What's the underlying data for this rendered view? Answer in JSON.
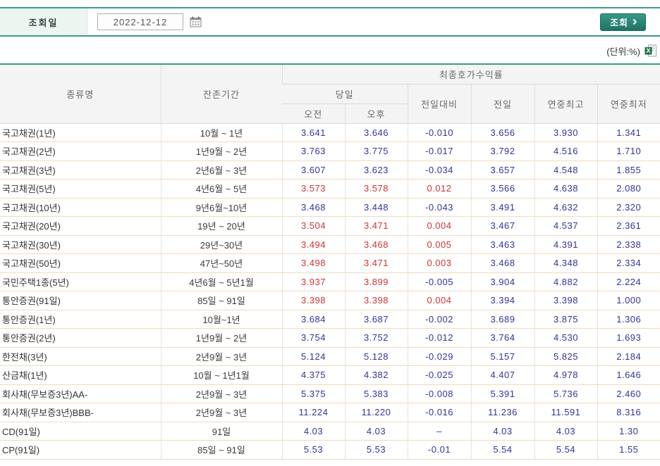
{
  "accent_color": "#3d9a8b",
  "colors": {
    "up": "#cc3333",
    "down": "#333399",
    "row_line": "#f0dac0"
  },
  "toolbar": {
    "date_label": "조회일",
    "date_value": "2022-12-12",
    "calendar_icon": "calendar-icon",
    "search_button_label": "조회"
  },
  "unit_note": "(단위:%)",
  "excel_icon": "excel-download-icon",
  "table": {
    "headers": {
      "type": "종류명",
      "period": "잔존기간",
      "yield_group": "최종호가수익률",
      "today": "당일",
      "am": "오전",
      "pm": "오후",
      "change": "전일대비",
      "prev": "전일",
      "year_high": "연중최고",
      "year_low": "연중최저"
    },
    "rows": [
      {
        "type": "국고채권(1년)",
        "period": "10월 ~ 1년",
        "am": "3.641",
        "pm": "3.646",
        "change": "-0.010",
        "prev": "3.656",
        "high": "3.930",
        "low": "1.341",
        "am_tone": "down",
        "pm_tone": "down",
        "change_tone": "down"
      },
      {
        "type": "국고채권(2년)",
        "period": "1년9월 ~ 2년",
        "am": "3.763",
        "pm": "3.775",
        "change": "-0.017",
        "prev": "3.792",
        "high": "4.516",
        "low": "1.710",
        "am_tone": "down",
        "pm_tone": "down",
        "change_tone": "down"
      },
      {
        "type": "국고채권(3년)",
        "period": "2년6월 ~ 3년",
        "am": "3.607",
        "pm": "3.623",
        "change": "-0.034",
        "prev": "3.657",
        "high": "4.548",
        "low": "1.855",
        "am_tone": "down",
        "pm_tone": "down",
        "change_tone": "down"
      },
      {
        "type": "국고채권(5년)",
        "period": "4년6월 ~ 5년",
        "am": "3.573",
        "pm": "3.578",
        "change": "0.012",
        "prev": "3.566",
        "high": "4.638",
        "low": "2.080",
        "am_tone": "up",
        "pm_tone": "up",
        "change_tone": "up"
      },
      {
        "type": "국고채권(10년)",
        "period": "9년6월~10년",
        "am": "3.468",
        "pm": "3.448",
        "change": "-0.043",
        "prev": "3.491",
        "high": "4.632",
        "low": "2.320",
        "am_tone": "down",
        "pm_tone": "down",
        "change_tone": "down"
      },
      {
        "type": "국고채권(20년)",
        "period": "19년 ~ 20년",
        "am": "3.504",
        "pm": "3.471",
        "change": "0.004",
        "prev": "3.467",
        "high": "4.537",
        "low": "2.361",
        "am_tone": "up",
        "pm_tone": "up",
        "change_tone": "up"
      },
      {
        "type": "국고채권(30년)",
        "period": "29년~30년",
        "am": "3.494",
        "pm": "3.468",
        "change": "0.005",
        "prev": "3.463",
        "high": "4.391",
        "low": "2.338",
        "am_tone": "up",
        "pm_tone": "up",
        "change_tone": "up"
      },
      {
        "type": "국고채권(50년)",
        "period": "47년~50년",
        "am": "3.498",
        "pm": "3.471",
        "change": "0.003",
        "prev": "3.468",
        "high": "4.348",
        "low": "2.334",
        "am_tone": "up",
        "pm_tone": "up",
        "change_tone": "up"
      },
      {
        "type": "국민주택1종(5년)",
        "period": "4년6월 ~ 5년1월",
        "am": "3.937",
        "pm": "3.899",
        "change": "-0.005",
        "prev": "3.904",
        "high": "4.882",
        "low": "2.224",
        "am_tone": "up",
        "pm_tone": "up",
        "change_tone": "down"
      },
      {
        "type": "통안증권(91일)",
        "period": "85일 ~ 91일",
        "am": "3.398",
        "pm": "3.398",
        "change": "0.004",
        "prev": "3.394",
        "high": "3.398",
        "low": "1.000",
        "am_tone": "up",
        "pm_tone": "up",
        "change_tone": "up"
      },
      {
        "type": "통안증권(1년)",
        "period": "10월~1년",
        "am": "3.684",
        "pm": "3.687",
        "change": "-0.002",
        "prev": "3.689",
        "high": "3.875",
        "low": "1.306",
        "am_tone": "down",
        "pm_tone": "down",
        "change_tone": "down"
      },
      {
        "type": "통안증권(2년)",
        "period": "1년9월 ~ 2년",
        "am": "3.754",
        "pm": "3.752",
        "change": "-0.012",
        "prev": "3.764",
        "high": "4.530",
        "low": "1.693",
        "am_tone": "down",
        "pm_tone": "down",
        "change_tone": "down"
      },
      {
        "type": "한전채(3년)",
        "period": "2년9월 ~ 3년",
        "am": "5.124",
        "pm": "5.128",
        "change": "-0.029",
        "prev": "5.157",
        "high": "5.825",
        "low": "2.184",
        "am_tone": "down",
        "pm_tone": "down",
        "change_tone": "down"
      },
      {
        "type": "산금채(1년)",
        "period": "10월 ~ 1년1월",
        "am": "4.375",
        "pm": "4.382",
        "change": "-0.025",
        "prev": "4.407",
        "high": "4.978",
        "low": "1.646",
        "am_tone": "down",
        "pm_tone": "down",
        "change_tone": "down"
      },
      {
        "type": "회사채(무보증3년)AA-",
        "period": "2년9월 ~ 3년",
        "am": "5.375",
        "pm": "5.383",
        "change": "-0.008",
        "prev": "5.391",
        "high": "5.736",
        "low": "2.460",
        "am_tone": "down",
        "pm_tone": "down",
        "change_tone": "down"
      },
      {
        "type": "회사채(무보증3년)BBB-",
        "period": "2년9월 ~ 3년",
        "am": "11.224",
        "pm": "11.220",
        "change": "-0.016",
        "prev": "11.236",
        "high": "11.591",
        "low": "8.316",
        "am_tone": "down",
        "pm_tone": "down",
        "change_tone": "down"
      },
      {
        "type": "CD(91일)",
        "period": "91일",
        "am": "4.03",
        "pm": "4.03",
        "change": "–",
        "prev": "4.03",
        "high": "4.03",
        "low": "1.30",
        "am_tone": "flat",
        "pm_tone": "flat",
        "change_tone": "flat"
      },
      {
        "type": "CP(91일)",
        "period": "85일 ~ 91일",
        "am": "5.53",
        "pm": "5.53",
        "change": "-0.01",
        "prev": "5.54",
        "high": "5.54",
        "low": "1.55",
        "am_tone": "down",
        "pm_tone": "down",
        "change_tone": "down"
      }
    ]
  }
}
